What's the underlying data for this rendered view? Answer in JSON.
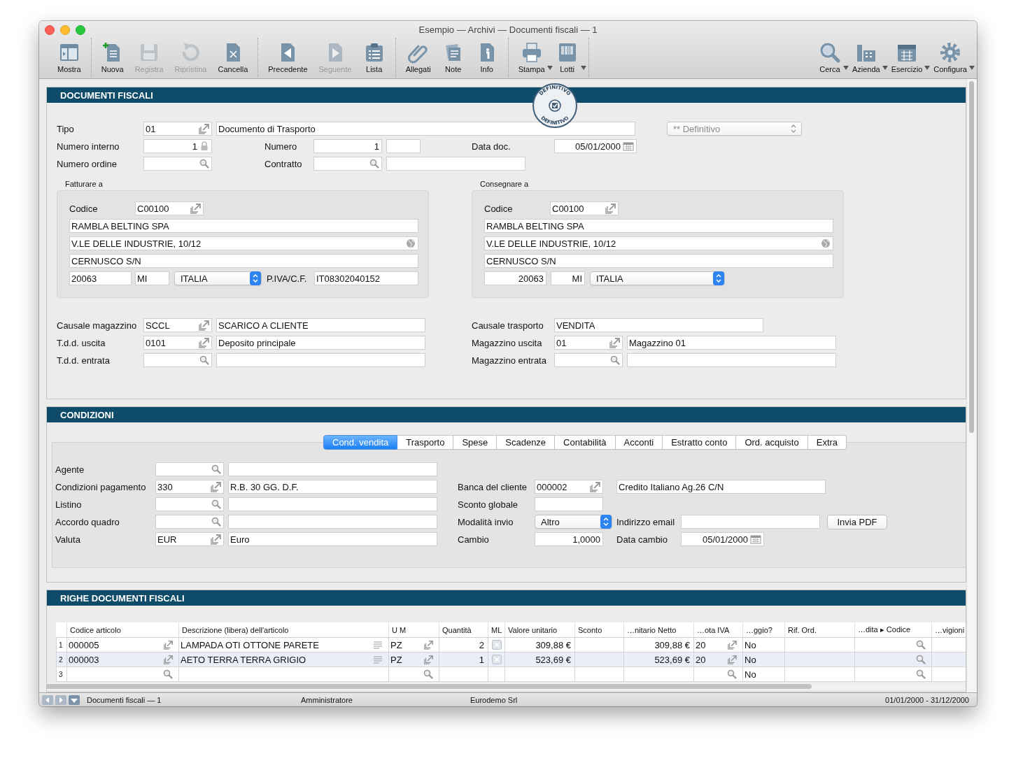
{
  "window": {
    "title": "Esempio — Archivi — Documenti fiscali — 1"
  },
  "toolbar": {
    "left_groups": [
      [
        {
          "label": "Mostra",
          "disabled": false,
          "menu": false
        }
      ],
      [
        {
          "label": "Nuova",
          "disabled": false,
          "menu": false
        },
        {
          "label": "Registra",
          "disabled": true,
          "menu": false
        },
        {
          "label": "Ripristina",
          "disabled": true,
          "menu": false
        },
        {
          "label": "Cancella",
          "disabled": false,
          "menu": false
        }
      ],
      [
        {
          "label": "Precedente",
          "disabled": false,
          "menu": false
        },
        {
          "label": "Seguente",
          "disabled": true,
          "menu": false
        },
        {
          "label": "Lista",
          "disabled": false,
          "menu": false
        }
      ],
      [
        {
          "label": "Allegati",
          "disabled": false,
          "menu": false
        },
        {
          "label": "Note",
          "disabled": false,
          "menu": false
        },
        {
          "label": "Info",
          "disabled": false,
          "menu": false
        }
      ],
      [
        {
          "label": "Stampa",
          "disabled": false,
          "menu": true
        },
        {
          "label": "Lotti",
          "disabled": false,
          "menu": true
        }
      ]
    ],
    "right_groups": [
      [
        {
          "label": "Cerca",
          "disabled": false,
          "menu": true
        },
        {
          "label": "Azienda",
          "disabled": false,
          "menu": true
        },
        {
          "label": "Esercizio",
          "disabled": false,
          "menu": true
        },
        {
          "label": "Configura",
          "disabled": false,
          "menu": true
        }
      ]
    ]
  },
  "documento": {
    "title": "DOCUMENTI FISCALI",
    "stamp": {
      "top_text": "DEFINITIVO",
      "bottom_text": "DEFINITIVO"
    },
    "rows": [
      [
        {
          "kind": "label",
          "text": "Tipo"
        },
        {
          "kind": "code",
          "value": "01"
        },
        {
          "kind": "text",
          "value": "Documento di Trasporto"
        },
        {
          "kind": "select",
          "value": "** Definitivo",
          "disabled": true
        }
      ],
      [
        {
          "kind": "label",
          "text": "Numero interno"
        },
        {
          "kind": "locked",
          "value": "1"
        },
        {
          "kind": "label",
          "text": "Numero"
        },
        {
          "kind": "right",
          "value": "1"
        },
        {
          "kind": "text"
        },
        {
          "kind": "label",
          "text": "Data doc."
        },
        {
          "kind": "date",
          "value": "05/01/2000"
        }
      ],
      [
        {
          "kind": "label",
          "text": "Numero ordine"
        },
        {
          "kind": "search"
        },
        {
          "kind": "label",
          "text": "Contratto"
        },
        {
          "kind": "search"
        },
        {
          "kind": "text"
        }
      ]
    ],
    "addresses": [
      {
        "caption": "Fatturare a",
        "rows": [
          [
            {
              "kind": "label",
              "text": "Codice"
            },
            {
              "kind": "code",
              "value": "C00100"
            }
          ],
          [
            {
              "kind": "text",
              "value": "RAMBLA BELTING SPA"
            }
          ],
          [
            {
              "kind": "address",
              "value": "V.LE DELLE INDUSTRIE, 10/12"
            }
          ],
          [
            {
              "kind": "text",
              "value": "CERNUSCO S/N"
            }
          ],
          [
            {
              "kind": "text",
              "value": "20063"
            },
            {
              "kind": "text",
              "value": "MI"
            },
            {
              "kind": "select",
              "value": "ITALIA",
              "disabled": false
            },
            {
              "kind": "label",
              "text": "P.IVA/C.F."
            },
            {
              "kind": "text",
              "value": "IT08302040152"
            }
          ]
        ]
      },
      {
        "caption": "Consegnare a",
        "rows": [
          [
            {
              "kind": "label",
              "text": "Codice"
            },
            {
              "kind": "code",
              "value": "C00100"
            }
          ],
          [
            {
              "kind": "text",
              "value": "RAMBLA BELTING SPA"
            }
          ],
          [
            {
              "kind": "address",
              "value": "V.LE DELLE INDUSTRIE, 10/12"
            }
          ],
          [
            {
              "kind": "text",
              "value": "CERNUSCO S/N"
            }
          ],
          [
            {
              "kind": "right",
              "value": "20063"
            },
            {
              "kind": "right",
              "value": "MI"
            },
            {
              "kind": "select",
              "value": "ITALIA",
              "disabled": false
            }
          ]
        ]
      }
    ],
    "left_rows": [
      [
        {
          "kind": "label",
          "text": "Causale magazzino"
        },
        {
          "kind": "code",
          "value": "SCCL"
        },
        {
          "kind": "text",
          "value": "SCARICO A CLIENTE"
        }
      ],
      [
        {
          "kind": "label",
          "text": "T.d.d. uscita"
        },
        {
          "kind": "code",
          "value": "0101"
        },
        {
          "kind": "text",
          "value": "Deposito principale"
        }
      ],
      [
        {
          "kind": "label",
          "text": "T.d.d. entrata"
        },
        {
          "kind": "search"
        },
        {
          "kind": "text"
        }
      ]
    ],
    "right_rows": [
      [
        {
          "kind": "label",
          "text": "Causale trasporto"
        },
        {
          "kind": "text",
          "value": "VENDITA"
        }
      ],
      [
        {
          "kind": "label",
          "text": "Magazzino uscita"
        },
        {
          "kind": "code",
          "value": "01"
        },
        {
          "kind": "text",
          "value": "Magazzino 01"
        }
      ],
      [
        {
          "kind": "label",
          "text": "Magazzino entrata"
        },
        {
          "kind": "search"
        },
        {
          "kind": "text"
        }
      ]
    ]
  },
  "condizioni": {
    "title": "CONDIZIONI",
    "tabs": [
      {
        "label": "Cond. vendita",
        "selected": true
      },
      {
        "label": "Trasporto",
        "selected": false
      },
      {
        "label": "Spese",
        "selected": false
      },
      {
        "label": "Scadenze",
        "selected": false
      },
      {
        "label": "Contabilità",
        "selected": false
      },
      {
        "label": "Acconti",
        "selected": false
      },
      {
        "label": "Estratto conto",
        "selected": false
      },
      {
        "label": "Ord. acquisto",
        "selected": false
      },
      {
        "label": "Extra",
        "selected": false
      }
    ],
    "rows": [
      [
        {
          "kind": "label",
          "text": "Agente"
        },
        {
          "kind": "search"
        },
        {
          "kind": "text"
        }
      ],
      [
        {
          "kind": "label",
          "text": "Condizioni pagamento"
        },
        {
          "kind": "code",
          "value": "330"
        },
        {
          "kind": "text",
          "value": "R.B. 30 GG. D.F."
        },
        {
          "kind": "label",
          "text": "Banca del cliente"
        },
        {
          "kind": "code",
          "value": "000002"
        },
        {
          "kind": "text",
          "value": "Credito Italiano Ag.26 C/N"
        }
      ],
      [
        {
          "kind": "label",
          "text": "Listino"
        },
        {
          "kind": "search"
        },
        {
          "kind": "text"
        },
        {
          "kind": "label",
          "text": "Sconto globale"
        },
        {
          "kind": "text"
        }
      ],
      [
        {
          "kind": "label",
          "text": "Accordo quadro"
        },
        {
          "kind": "search"
        },
        {
          "kind": "text"
        },
        {
          "kind": "label",
          "text": "Modalità invio"
        },
        {
          "kind": "select",
          "value": "Altro",
          "disabled": false
        },
        {
          "kind": "label",
          "text": "Indirizzo email"
        },
        {
          "kind": "text"
        },
        {
          "kind": "button",
          "text": "Invia PDF"
        }
      ],
      [
        {
          "kind": "label",
          "text": "Valuta"
        },
        {
          "kind": "code",
          "value": "EUR"
        },
        {
          "kind": "text",
          "value": "Euro"
        },
        {
          "kind": "label",
          "text": "Cambio"
        },
        {
          "kind": "right",
          "value": "1,0000"
        },
        {
          "kind": "label",
          "text": "Data cambio"
        },
        {
          "kind": "date",
          "value": "05/01/2000"
        }
      ]
    ]
  },
  "righe": {
    "title": "RIGHE DOCUMENTI FISCALI",
    "columns": [
      "Codice articolo",
      "Descrizione (libera) dell'articolo",
      "U M",
      "Quantità",
      "ML",
      "Valore unitario",
      "Sconto",
      "…nitario Netto",
      "…ota IVA",
      "…ggio?",
      "Rif. Ord.",
      "…dita ▸ Codice",
      "…vigioni"
    ],
    "rows": [
      {
        "number": "1",
        "cells": [
          {
            "kind": "code",
            "value": "000005"
          },
          {
            "kind": "memo",
            "value": "LAMPADA OTI OTTONE PARETE"
          },
          {
            "kind": "code",
            "value": "PZ"
          },
          {
            "kind": "right",
            "value": "2"
          },
          {
            "kind": "flag",
            "checked": true
          },
          {
            "kind": "right",
            "value": "309,88 €"
          },
          {
            "kind": "text"
          },
          {
            "kind": "right",
            "value": "309,88 €"
          },
          {
            "kind": "code",
            "value": "20"
          },
          {
            "kind": "text",
            "value": "No"
          },
          {
            "kind": "text"
          },
          {
            "kind": "search"
          },
          {
            "kind": "text"
          }
        ]
      },
      {
        "number": "2",
        "cells": [
          {
            "kind": "code",
            "value": "000003"
          },
          {
            "kind": "memo",
            "value": "AETO TERRA TERRA GRIGIO"
          },
          {
            "kind": "code",
            "value": "PZ"
          },
          {
            "kind": "right",
            "value": "1"
          },
          {
            "kind": "flag",
            "checked": true
          },
          {
            "kind": "right",
            "value": "523,69 €"
          },
          {
            "kind": "text"
          },
          {
            "kind": "right",
            "value": "523,69 €"
          },
          {
            "kind": "code",
            "value": "20"
          },
          {
            "kind": "text",
            "value": "No"
          },
          {
            "kind": "text"
          },
          {
            "kind": "search"
          },
          {
            "kind": "text"
          }
        ]
      },
      {
        "number": "3",
        "cells": [
          {
            "kind": "search"
          },
          {
            "kind": "text"
          },
          {
            "kind": "search"
          },
          {
            "kind": "text"
          },
          {
            "kind": "text"
          },
          {
            "kind": "text"
          },
          {
            "kind": "text"
          },
          {
            "kind": "text"
          },
          {
            "kind": "search"
          },
          {
            "kind": "text",
            "value": "No"
          },
          {
            "kind": "text"
          },
          {
            "kind": "search"
          },
          {
            "kind": "text"
          }
        ]
      }
    ]
  },
  "status_bar": {
    "document": "Documenti fiscali — 1",
    "user": "Amministratore",
    "company": "Eurodemo Srl",
    "period": "01/01/2000 - 31/12/2000"
  }
}
